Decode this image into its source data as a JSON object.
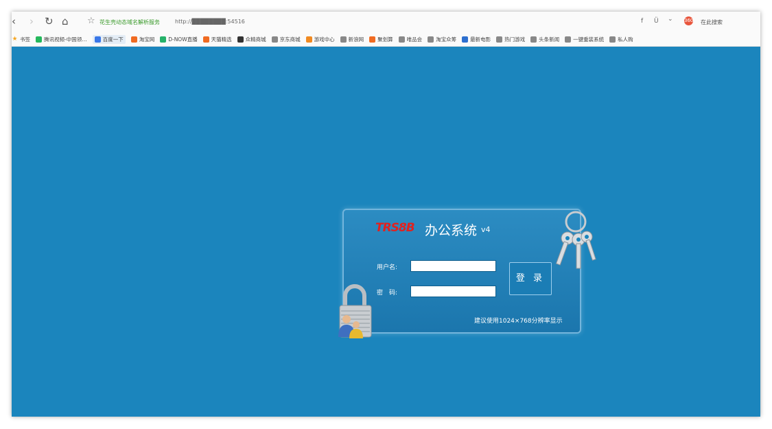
{
  "browser": {
    "back_icon": "‹",
    "forward_icon": "›",
    "reload_icon": "↻",
    "home_icon": "⌂",
    "star_icon": "☆",
    "address_prefix": "花生壳动态域名解析服务",
    "address_url": "http://████████:54516",
    "right_f": "f",
    "right_shield": "Ü",
    "right_chevron": "⌄",
    "search_engine": "360",
    "search_text": "在此搜索"
  },
  "bookmarks": [
    {
      "label": "书签",
      "color": "#f5a623"
    },
    {
      "label": "腾讯视频-中国领…",
      "color": "#25b85c"
    },
    {
      "label": "百度一下",
      "color": "#3a77e8"
    },
    {
      "label": "淘宝网",
      "color": "#f06b22"
    },
    {
      "label": "D-NOW直播",
      "color": "#26b26a"
    },
    {
      "label": "天猫精选",
      "color": "#f06b22"
    },
    {
      "label": "众精商城",
      "color": "#333333"
    },
    {
      "label": "京东商城",
      "color": "#888888"
    },
    {
      "label": "游戏中心",
      "color": "#f08a22"
    },
    {
      "label": "新浪网",
      "color": "#888888"
    },
    {
      "label": "聚划算",
      "color": "#f06b22"
    },
    {
      "label": "唯品会",
      "color": "#888888"
    },
    {
      "label": "淘宝众筹",
      "color": "#888888"
    },
    {
      "label": "最新电影",
      "color": "#2d6fcf"
    },
    {
      "label": "热门游戏",
      "color": "#888888"
    },
    {
      "label": "头条新闻",
      "color": "#888888"
    },
    {
      "label": "一键重装系统",
      "color": "#888888"
    },
    {
      "label": "私人购",
      "color": "#888888"
    }
  ],
  "login": {
    "brand": "TRS8B",
    "title": "办公系统",
    "version": "v4",
    "username_label": "用户名:",
    "username_value": "",
    "password_label": "密　码:",
    "password_value": "",
    "login_button": "登 录",
    "hint": "建议使用1024×768分辨率显示"
  }
}
